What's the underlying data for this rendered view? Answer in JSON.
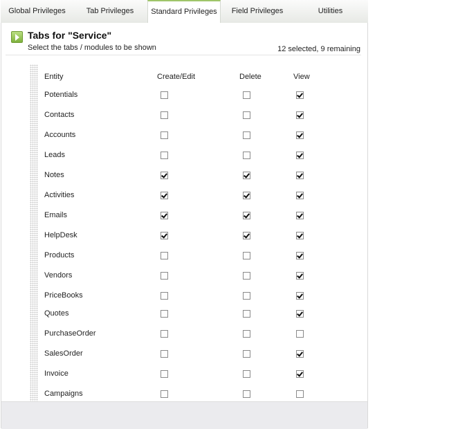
{
  "tabs": [
    {
      "label": "Global Privileges",
      "active": false
    },
    {
      "label": "Tab Privileges",
      "active": false
    },
    {
      "label": "Standard Privileges",
      "active": true
    },
    {
      "label": "Field Privileges",
      "active": false
    },
    {
      "label": "Utilities",
      "active": false
    }
  ],
  "header": {
    "title": "Tabs for \"Service\"",
    "subtitle": "Select the tabs / modules to be shown",
    "count": "12 selected, 9 remaining"
  },
  "table": {
    "columns": [
      "Entity",
      "Create/Edit",
      "Delete",
      "View"
    ],
    "rows": [
      {
        "entity": "Potentials",
        "create_edit": false,
        "delete": false,
        "view": true
      },
      {
        "entity": "Contacts",
        "create_edit": false,
        "delete": false,
        "view": true
      },
      {
        "entity": "Accounts",
        "create_edit": false,
        "delete": false,
        "view": true
      },
      {
        "entity": "Leads",
        "create_edit": false,
        "delete": false,
        "view": true
      },
      {
        "entity": "Notes",
        "create_edit": true,
        "delete": true,
        "view": true
      },
      {
        "entity": "Activities",
        "create_edit": true,
        "delete": true,
        "view": true
      },
      {
        "entity": "Emails",
        "create_edit": true,
        "delete": true,
        "view": true
      },
      {
        "entity": "HelpDesk",
        "create_edit": true,
        "delete": true,
        "view": true
      },
      {
        "entity": "Products",
        "create_edit": false,
        "delete": false,
        "view": true
      },
      {
        "entity": "Vendors",
        "create_edit": false,
        "delete": false,
        "view": true
      },
      {
        "entity": "PriceBooks",
        "create_edit": false,
        "delete": false,
        "view": true
      },
      {
        "entity": "Quotes",
        "create_edit": false,
        "delete": false,
        "view": true
      },
      {
        "entity": "PurchaseOrder",
        "create_edit": false,
        "delete": false,
        "view": false
      },
      {
        "entity": "SalesOrder",
        "create_edit": false,
        "delete": false,
        "view": true
      },
      {
        "entity": "Invoice",
        "create_edit": false,
        "delete": false,
        "view": true
      },
      {
        "entity": "Campaigns",
        "create_edit": false,
        "delete": false,
        "view": false
      }
    ]
  }
}
